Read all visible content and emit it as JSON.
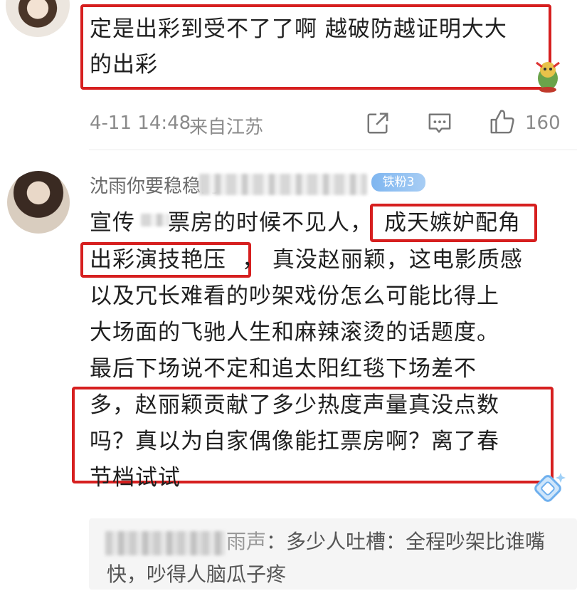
{
  "comment1": {
    "line1": "定是出彩到受不了了啊 越破防越证明大大",
    "line2": "的出彩",
    "meta": {
      "time": "4-11 14:48",
      "location": "来自江苏",
      "like_count": "160"
    }
  },
  "comment2": {
    "username_visible": "沈雨你要稳稳的",
    "fan_badge": "铁粉3",
    "lines": [
      {
        "pre": "宣传",
        "mid": "票房的时候不见人，",
        "boxed": "成天嫉妒配角"
      },
      {
        "boxed": "出彩演技艳压",
        "post": "， 真没赵丽颖，这电影质感"
      },
      {
        "text": "以及冗长难看的吵架戏份怎么可能比得上"
      },
      {
        "text": "大场面的飞驰人生和麻辣滚烫的话题度。"
      },
      {
        "text": "最后下场说不定和追太阳红毯下场差不"
      },
      {
        "text": "多，赵丽颖贡献了多少热度声量真没点数"
      },
      {
        "text": "吗？真以为自家偶像能扛票房啊？离了春"
      },
      {
        "text": "节档试试"
      }
    ]
  },
  "reply": {
    "name_tail": "雨声",
    "line1": "：多少人吐槽：全程吵架比谁嘴",
    "line2": "快，吵得人脑瓜子疼"
  },
  "colors": {
    "highlight_red": "#d61f1f",
    "badge_blue": "#7fb6f0",
    "meta_gray": "#8a8a8a"
  },
  "icons": [
    "share-icon",
    "comment-icon",
    "like-icon",
    "fan-badge-icon",
    "sticker-icon"
  ]
}
